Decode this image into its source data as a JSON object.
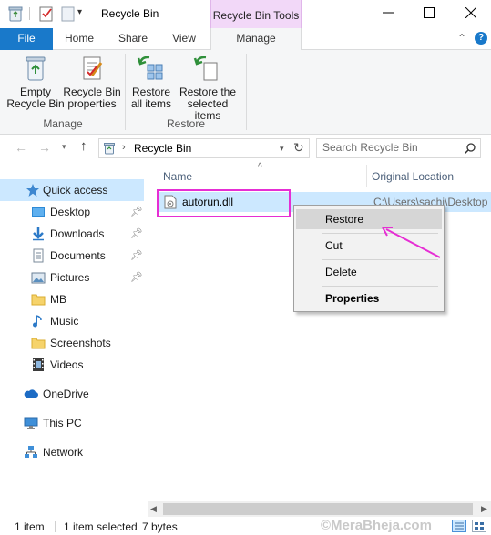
{
  "window": {
    "title": "Recycle Bin",
    "contextual_tab_group": "Recycle Bin Tools"
  },
  "ribbon_tabs": {
    "file": "File",
    "home": "Home",
    "share": "Share",
    "view": "View",
    "manage": "Manage"
  },
  "ribbon": {
    "empty_recycle_bin": "Empty\nRecycle Bin",
    "recycle_bin_properties": "Recycle Bin\nproperties",
    "restore_all_items": "Restore\nall items",
    "restore_selected_items": "Restore the\nselected items",
    "group_manage": "Manage",
    "group_restore": "Restore"
  },
  "address_bar": {
    "location": "Recycle Bin",
    "search_placeholder": "Search Recycle Bin"
  },
  "nav_pane": {
    "quick_access": "Quick access",
    "items": [
      {
        "label": "Desktop",
        "icon": "desktop-folder-icon",
        "pinned": true
      },
      {
        "label": "Downloads",
        "icon": "downloads-folder-icon",
        "pinned": true
      },
      {
        "label": "Documents",
        "icon": "documents-folder-icon",
        "pinned": true
      },
      {
        "label": "Pictures",
        "icon": "pictures-folder-icon",
        "pinned": true
      },
      {
        "label": "MB",
        "icon": "folder-icon",
        "pinned": false
      },
      {
        "label": "Music",
        "icon": "music-note-icon",
        "pinned": false
      },
      {
        "label": "Screenshots",
        "icon": "folder-icon",
        "pinned": false
      },
      {
        "label": "Videos",
        "icon": "videos-folder-icon",
        "pinned": false
      }
    ],
    "onedrive": "OneDrive",
    "this_pc": "This PC",
    "network": "Network"
  },
  "file_list": {
    "columns": [
      "Name",
      "Original Location"
    ],
    "rows": [
      {
        "name": "autorun.dll",
        "original_location": "C:\\Users\\sachi\\Desktop"
      }
    ]
  },
  "context_menu": {
    "restore": "Restore",
    "cut": "Cut",
    "delete": "Delete",
    "properties": "Properties"
  },
  "status_bar": {
    "item_count": "1 item",
    "selected": "1 item selected",
    "size": "7 bytes",
    "watermark": "©MeraBheja.com"
  },
  "colors": {
    "accent": "#1979ca",
    "selection": "#cce8ff",
    "contextual_tab": "#f2d8f8",
    "annotation": "#e62ed4"
  }
}
